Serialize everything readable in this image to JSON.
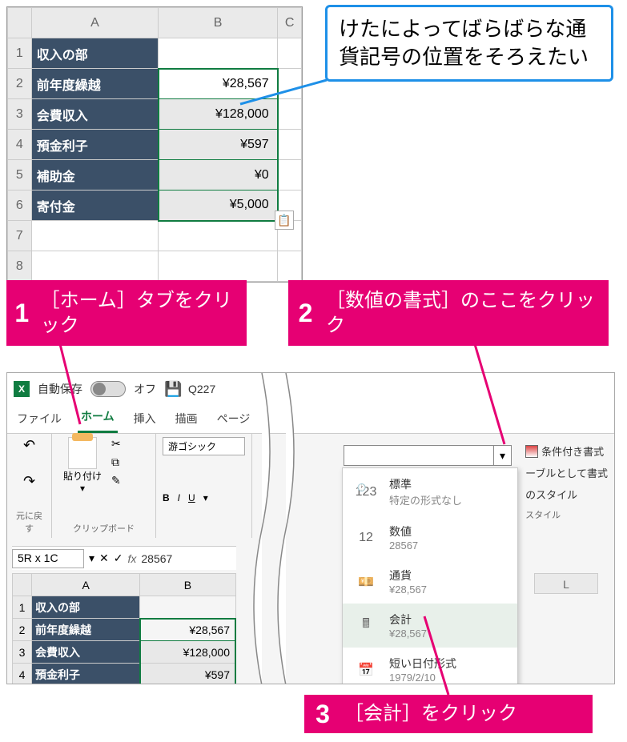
{
  "callout_blue": "けたによってばらばらな通貨記号の位置をそろえたい",
  "steps": {
    "s1_num": "1",
    "s1_txt": "［ホーム］タブをクリック",
    "s2_num": "2",
    "s2_txt": "［数値の書式］のここをクリック",
    "s3_num": "3",
    "s3_txt": "［会計］をクリック"
  },
  "sheet_top": {
    "cols": [
      "A",
      "B",
      "C"
    ],
    "rows": [
      "1",
      "2",
      "3",
      "4",
      "5",
      "6",
      "7",
      "8"
    ],
    "a1": "収入の部",
    "labels": [
      "前年度繰越",
      "会費収入",
      "預金利子",
      "補助金",
      "寄付金"
    ],
    "values": [
      "¥28,567",
      "¥128,000",
      "¥597",
      "¥0",
      "¥5,000"
    ]
  },
  "qat": {
    "autosave": "自動保存",
    "off": "オフ",
    "docname": "Q227"
  },
  "tabs": {
    "file": "ファイル",
    "home": "ホーム",
    "insert": "挿入",
    "draw": "描画",
    "page": "ページ"
  },
  "ribbon": {
    "undo": "元に戻す",
    "clipboard": "クリップボード",
    "paste": "貼り付け",
    "font_name": "游ゴシック",
    "bold": "B",
    "italic": "I",
    "underline": "U",
    "cond_format": "条件付き書式",
    "table_format": "ーブルとして書式",
    "cell_style": "のスタイル",
    "styles": "スタイル"
  },
  "formula": {
    "namebox": "5R x 1C",
    "fx": "fx",
    "value": "28567"
  },
  "sheet_low": {
    "cols": [
      "A",
      "B"
    ],
    "a1": "収入の部",
    "labels": [
      "前年度繰越",
      "会費収入",
      "預金利子"
    ],
    "values": [
      "¥28,567",
      "¥128,000",
      "¥597"
    ],
    "colL": "L"
  },
  "dropdown": {
    "standard": {
      "t": "標準",
      "s": "特定の形式なし",
      "icon": "123"
    },
    "number": {
      "t": "数値",
      "s": "28567",
      "icon": "12"
    },
    "currency": {
      "t": "通貨",
      "s": "¥28,567"
    },
    "accounting": {
      "t": "会計",
      "s": "¥28,567"
    },
    "shortdate": {
      "t": "短い日付形式",
      "s": "1979/2/10"
    }
  },
  "icons": {
    "dropdown": "▾",
    "cut": "✂",
    "brush": "✎",
    "qa": "📋",
    "calc": "🖩",
    "money": "💴",
    "cal": "📅",
    "clock": "🕐"
  }
}
